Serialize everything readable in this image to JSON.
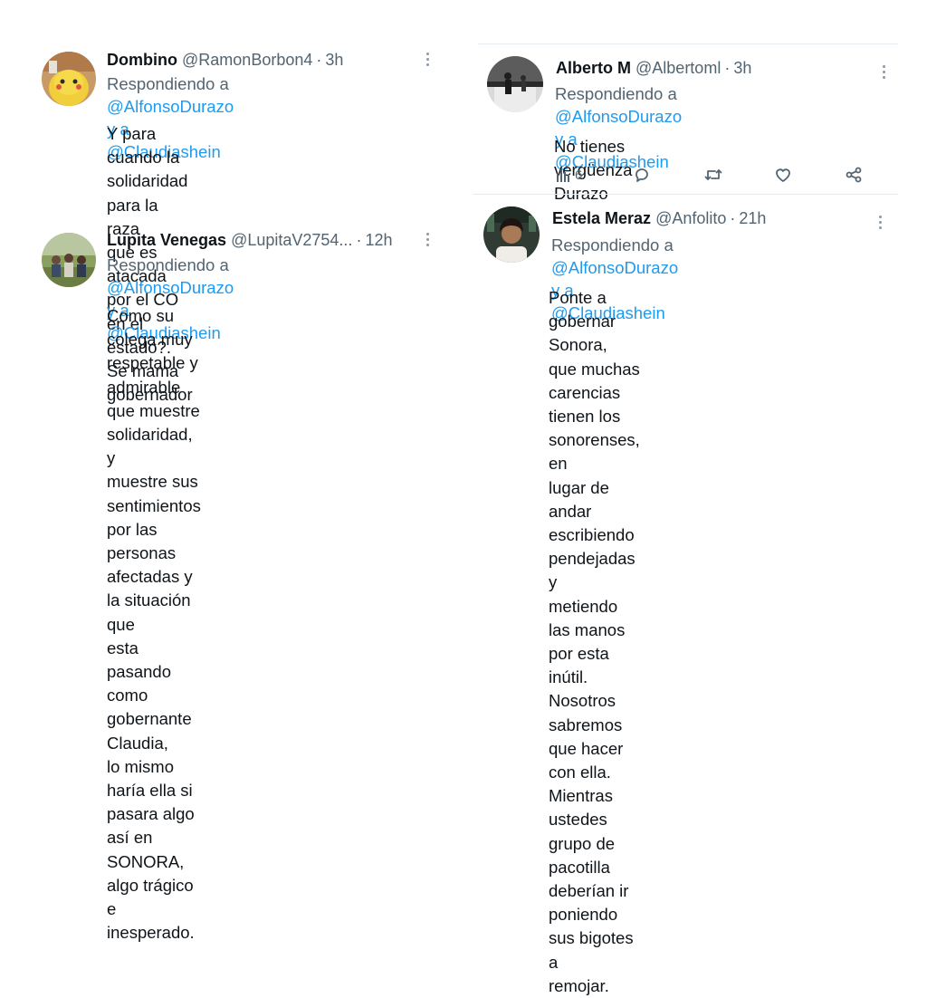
{
  "tweets": {
    "t1": {
      "name": "Dombino",
      "handle": "@RamonBorbon4",
      "time": "3h",
      "reply_prefix": "Respondiendo a",
      "mention1": "@AlfonsoDurazo y a",
      "mention2": "@Claudiashein",
      "body": [
        "Y para cuando la solidaridad para la raza",
        "que es atacada por el CO en el estado?.",
        "Se mama gobernador"
      ]
    },
    "t2": {
      "name": "Lupita Venegas",
      "handle": "@LupitaV2754...",
      "time": "12h",
      "reply_prefix": "Respondiendo a",
      "mention1": "@AlfonsoDurazo y a",
      "mention2": "@Claudiashein",
      "body": [
        "Como su colega muy respetable y",
        "admirable que muestre solidaridad, y",
        "muestre sus sentimientos por las",
        "personas afectadas y la situación que",
        "esta pasando como gobernante Claudia,",
        "lo mismo haría ella si pasara algo así en",
        "SONORA, algo trágico e inesperado."
      ]
    },
    "t3": {
      "name": "Alberto M",
      "handle": "@Albertoml",
      "time": "3h",
      "reply_prefix": "Respondiendo a",
      "mention1": "@AlfonsoDurazo y a",
      "mention2": "@Claudiashein",
      "body": [
        "No tienes vergüenza Durazo"
      ],
      "views": "6"
    },
    "t4": {
      "name": "Estela Meraz",
      "handle": "@Anfolito",
      "time": "21h",
      "reply_prefix": "Respondiendo a",
      "mention1": "@AlfonsoDurazo y a",
      "mention2": "@Claudiashein",
      "body": [
        "Ponte a gobernar Sonora, que muchas",
        "carencias tienen los sonorenses, en",
        "lugar de andar escribiendo pendejadas y",
        "metiendo las manos por esta inútil.",
        "Nosotros sabremos que hacer con ella.",
        "Mientras ustedes grupo de pacotilla",
        "deberían ir poniendo sus bigotes a",
        "remojar."
      ]
    }
  },
  "icons": {
    "more": "more-vertical-icon",
    "views": "analytics-icon",
    "reply": "reply-icon",
    "retweet": "retweet-icon",
    "like": "heart-icon",
    "share": "share-icon"
  },
  "colors": {
    "mention": "#1d9bf0",
    "secondary": "#536471",
    "text": "#0f1419"
  }
}
